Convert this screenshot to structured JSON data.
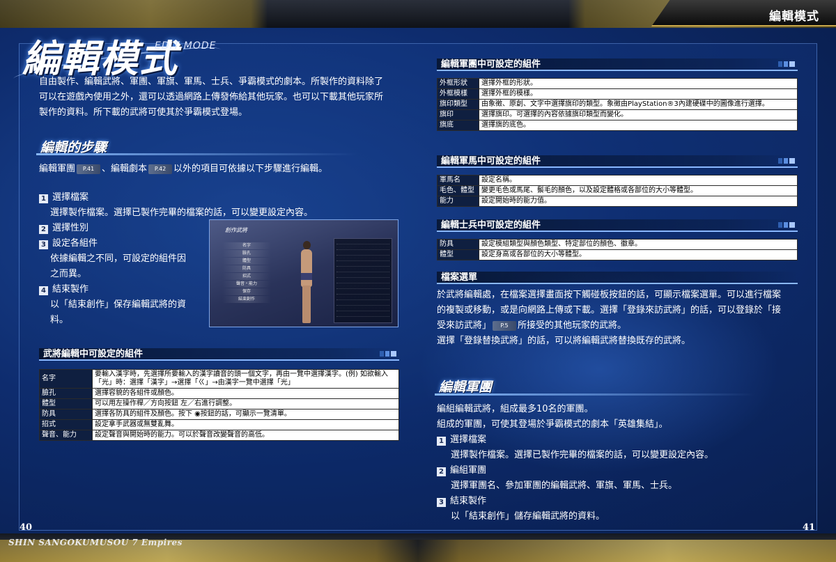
{
  "header": {
    "section_label": "編輯模式"
  },
  "title": {
    "main": "編輯模式",
    "sub": "EDIT MODE"
  },
  "intro": {
    "lines": [
      "自由製作、編輯武將、軍團、軍旗、軍馬、士兵、爭霸模式的劇本。所製作的資料除了",
      "可以在遊戲內使用之外，還可以透過網路上傳發佈給其他玩家。也可以下載其他玩家所",
      "製作的資料。所下載的武將可使其於爭霸模式登場。"
    ]
  },
  "steps_section": {
    "heading": "編輯的步驟",
    "ref_line": {
      "a": "編輯軍團",
      "ref1": "P.41",
      "b": "、編輯劇本",
      "ref2": "P.42",
      "c": "以外的項目可依據以下步驟進行編輯。"
    },
    "steps": [
      {
        "num": "1",
        "title": "選擇檔案",
        "desc": [
          "選擇製作檔案。選擇已製作完畢的檔案的話，可以變更設定內容。"
        ]
      },
      {
        "num": "2",
        "title": "選擇性別",
        "desc": []
      },
      {
        "num": "3",
        "title": "設定各組件",
        "desc": [
          "依據編輯之不同，可設定的組件因",
          "之而異。"
        ]
      },
      {
        "num": "4",
        "title": "結束製作",
        "desc": [
          "以「結束創作」保存編輯武將的資",
          "料。"
        ]
      }
    ]
  },
  "screenshot": {
    "title": "創作武將",
    "menu": [
      "名字",
      "臉孔",
      "體型",
      "防具",
      "招式",
      "聲音・能力",
      "保存",
      "結束創作"
    ]
  },
  "general_components": {
    "heading": "武將編輯中可設定的組件",
    "rows": [
      {
        "key": "名字",
        "value": "要輸入漢字時，先選擇所要輸入的漢字讀音的頭一個文字，再由一覽中選擇漢字。(例) 如欲輸入「光」時：選擇「漢字」→選擇「ㄍ」→由漢字一覽中選擇「光」"
      },
      {
        "key": "臉孔",
        "value": "選擇容貌的各組件或顏色。"
      },
      {
        "key": "體型",
        "value": "可以用左操作桿／方向按鈕 左／右進行調整。"
      },
      {
        "key": "防具",
        "value": "選擇各防具的組件及顏色。按下 ◉按鈕的話，可顯示一覽清單。"
      },
      {
        "key": "招式",
        "value": "設定拿手武器或無雙亂舞。"
      },
      {
        "key": "聲音、能力",
        "value": "設定聲音與開始時的能力。可以於聲音改變聲音的高低。"
      }
    ]
  },
  "corps_components": {
    "heading": "編輯軍團中可設定的組件",
    "rows": [
      {
        "key": "外框形狀",
        "value": "選擇外框的形狀。"
      },
      {
        "key": "外框模樣",
        "value": "選擇外框的模樣。"
      },
      {
        "key": "旗印類型",
        "value": "由象徵、原創、文字中選擇旗印的類型。象徵由PlayStation®3內建硬碟中的圖像進行選擇。"
      },
      {
        "key": "旗印",
        "value": "選擇旗印。可選擇的內容依據旗印類型而變化。"
      },
      {
        "key": "旗底",
        "value": "選擇旗的底色。"
      }
    ]
  },
  "horse_components": {
    "heading": "編輯軍馬中可設定的組件",
    "rows": [
      {
        "key": "軍馬名",
        "value": "設定名稱。"
      },
      {
        "key": "毛色、體型",
        "value": "變更毛色或馬尾、鬃毛的顏色，以及設定體格或各部位的大小等體型。"
      },
      {
        "key": "能力",
        "value": "設定開始時的能力值。"
      }
    ]
  },
  "soldier_components": {
    "heading": "編輯士兵中可設定的組件",
    "rows": [
      {
        "key": "防具",
        "value": "設定模組類型與顏色類型、特定部位的顏色、徽章。"
      },
      {
        "key": "體型",
        "value": "設定身高或各部位的大小等體型。"
      }
    ]
  },
  "file_menu": {
    "heading": "檔案選單",
    "line1": "於武將編輯處，在檔案選擇畫面按下觸碰板按鈕的話，可顯示檔案選單。可以進行檔案",
    "line2": "的複製或移動，或是向網路上傳或下載。選擇「登錄來訪武將」的話，可以登錄於「接",
    "line3a": "受來訪武將」",
    "ref": "P.5",
    "line3b": "所接受的其他玩家的武將。",
    "line4": "選擇「登錄替換武將」的話，可以將編輯武將替換既存的武將。"
  },
  "edit_corps": {
    "heading": "編輯軍團",
    "lines": [
      "編組編輯武將，組成最多10名的軍團。",
      "組成的軍團，可使其登場於爭霸模式的劇本「英雄集結」。"
    ],
    "steps": [
      {
        "num": "1",
        "title": "選擇檔案",
        "desc": "選擇製作檔案。選擇已製作完畢的檔案的話，可以變更設定內容。"
      },
      {
        "num": "2",
        "title": "編組軍團",
        "desc": "選擇軍團名、參加軍團的編輯武將、軍旗、軍馬、士兵。"
      },
      {
        "num": "3",
        "title": "結束製作",
        "desc": "以「結束創作」儲存編輯武將的資料。"
      }
    ]
  },
  "footer": {
    "game_title": "SHIN SANGOKUMUSOU 7 Empires",
    "page_left": "40",
    "page_right": "41"
  }
}
